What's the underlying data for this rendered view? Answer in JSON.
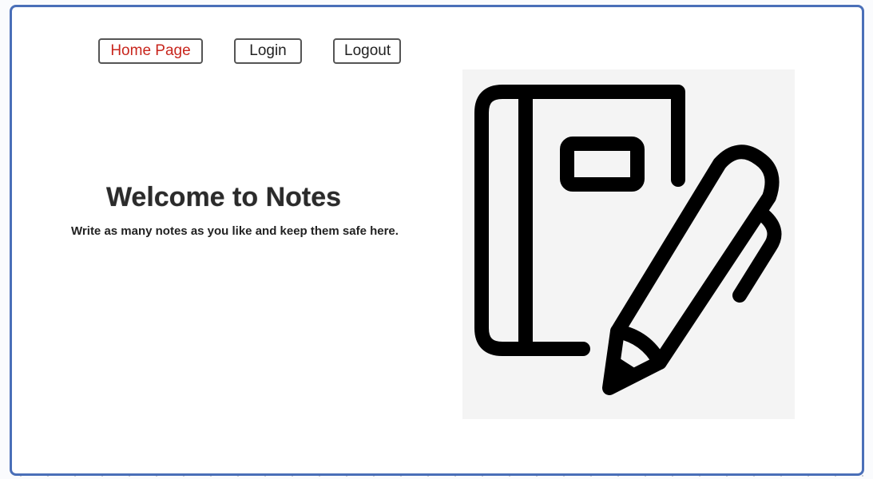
{
  "nav": {
    "items": [
      {
        "label": "Home Page",
        "active": true
      },
      {
        "label": "Login",
        "active": false
      },
      {
        "label": "Logout",
        "active": false
      }
    ]
  },
  "hero": {
    "title": "Welcome to Notes",
    "subtitle": "Write as many notes as you like and keep them safe here."
  },
  "illustration": {
    "icon": "notebook-pen-icon"
  },
  "colors": {
    "frame_border": "#4a6fb8",
    "active_nav_text": "#c8261d",
    "nav_text": "#222222",
    "illustration_background": "#f4f4f4",
    "icon_stroke": "#000000"
  }
}
